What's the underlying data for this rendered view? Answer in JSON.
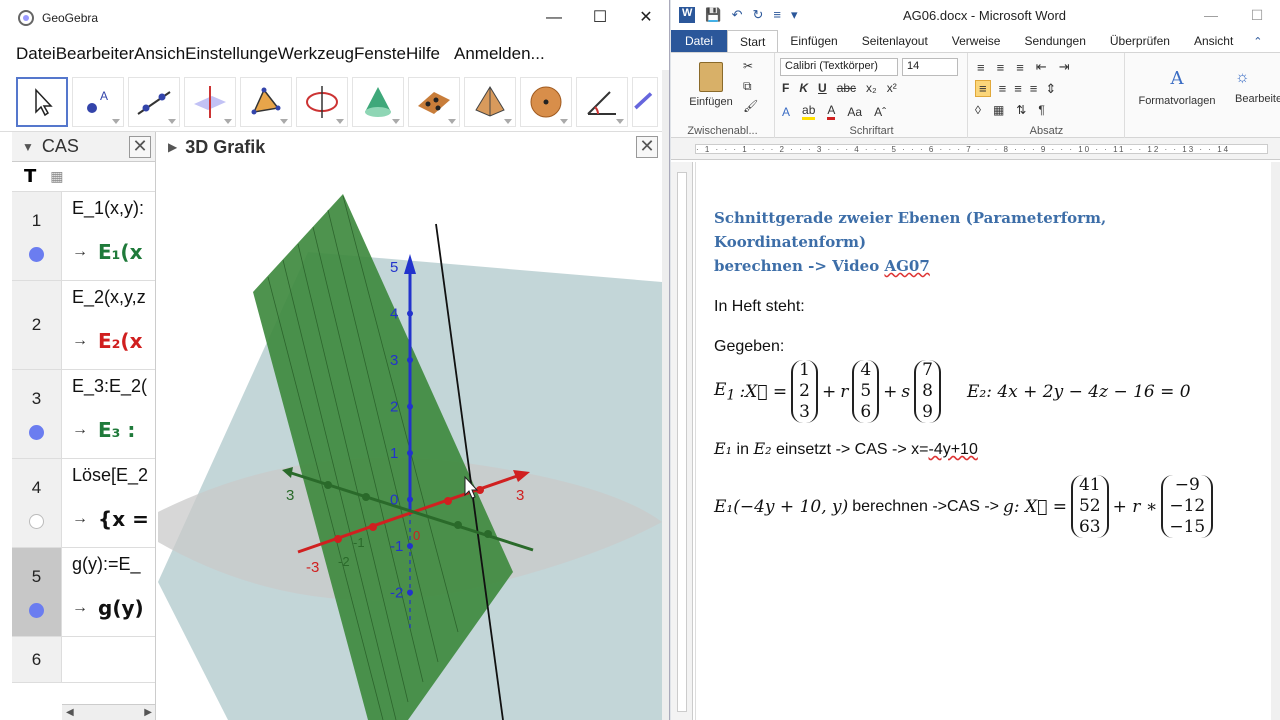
{
  "geogebra": {
    "window_title": "GeoGebra",
    "menu": [
      "Datei",
      "Bearbeiter",
      "Ansich",
      "Einstellunge",
      "Werkzeug",
      "Fenste",
      "Hilfe",
      "Anmelden..."
    ],
    "toolbar_icons": [
      "move-icon",
      "point-icon",
      "line-icon",
      "perpendicular-line-icon",
      "polygon-icon",
      "circle-icon",
      "cone-icon",
      "plane-icon",
      "pyramid-icon",
      "sphere-icon",
      "angle-icon",
      "reflect-icon"
    ],
    "cas": {
      "title": "CAS",
      "tool_text": "T",
      "rows": [
        {
          "num": "1",
          "input": "E_1(x,y):",
          "output_name": "E₁(x",
          "color": "#1f7a3a",
          "dot": "filled"
        },
        {
          "num": "2",
          "input": "E_2(x,y,z",
          "output_name": "E₂(x",
          "color": "#d01f1f",
          "dot": "none"
        },
        {
          "num": "3",
          "input": "E_3:E_2(",
          "output_name": "E₃ :",
          "color": "#1f7a3a",
          "dot": "filled"
        },
        {
          "num": "4",
          "input": "Löse[E_2",
          "output_name": "{x =",
          "color": "#111111",
          "dot": "hollow"
        },
        {
          "num": "5",
          "input": "g(y):=E_",
          "output_name": "g(y)",
          "color": "#111111",
          "dot": "filled"
        },
        {
          "num": "6",
          "input": "",
          "output_name": "",
          "color": "#111111",
          "dot": "none"
        }
      ],
      "arrow": "→"
    },
    "graphics3d": {
      "title": "3D Grafik",
      "z_ticks": [
        "5",
        "4",
        "3",
        "2",
        "1",
        "0",
        "-1",
        "-2"
      ],
      "x_labels": [
        "3",
        "-3"
      ],
      "y_labels": [
        "3",
        "0",
        "-1",
        "-2"
      ]
    }
  },
  "word": {
    "window_title": "AG06.docx - Microsoft Word",
    "tabs": [
      "Datei",
      "Start",
      "Einfügen",
      "Seitenlayout",
      "Verweise",
      "Sendungen",
      "Überprüfen",
      "Ansicht"
    ],
    "groups": {
      "clipboard": "Zwischenabl...",
      "clipboard_button": "Einfügen",
      "font": "Schriftart",
      "font_name": "Calibri (Textkörper)",
      "font_size": "14",
      "paragraph": "Absatz",
      "styles": "Formatvorlagen",
      "edit": "Bearbeiten"
    },
    "ruler_text": "· 1 · · · 1 · · · 2 · · · 3 · · · 4 · · · 5 · · · 6 · · · 7 · · · 8 · · · 9 · · · 10 · · 11 · · 12 · · 13 · · 14",
    "doc": {
      "heading_line1": "Schnittgerade zweier Ebenen (Parameterform, Koordinatenform)",
      "heading_line2_prefix": "berechnen -> Video ",
      "heading_line2_code": "AG07",
      "line_heft": "In Heft steht:",
      "line_gegeben": "Gegeben:",
      "e1_label": "E",
      "e1_sub": "1",
      "e1_eq": ":X⃗ =",
      "v1": [
        "1",
        "2",
        "3"
      ],
      "v2": [
        "4",
        "5",
        "6"
      ],
      "v3": [
        "7",
        "8",
        "9"
      ],
      "r": "r",
      "s": "s",
      "plus": "+",
      "e2_eq": "E₂: 4x + 2y − 4z − 16 = 0",
      "subst_1": "E₁",
      "subst_text": " in ",
      "subst_2": "E₂",
      "subst_rest": " einsetzt -> CAS -> x=",
      "subst_val": "-4y+10",
      "calc_prefix": "E₁(−4y + 10, y)",
      "calc_text": " berechnen ->CAS -> ",
      "calc_g": "g: X⃗ =",
      "g_p": [
        "41",
        "52",
        "63"
      ],
      "g_r": "+ r ∗",
      "g_d": [
        "−9",
        "−12",
        "−15"
      ]
    }
  }
}
